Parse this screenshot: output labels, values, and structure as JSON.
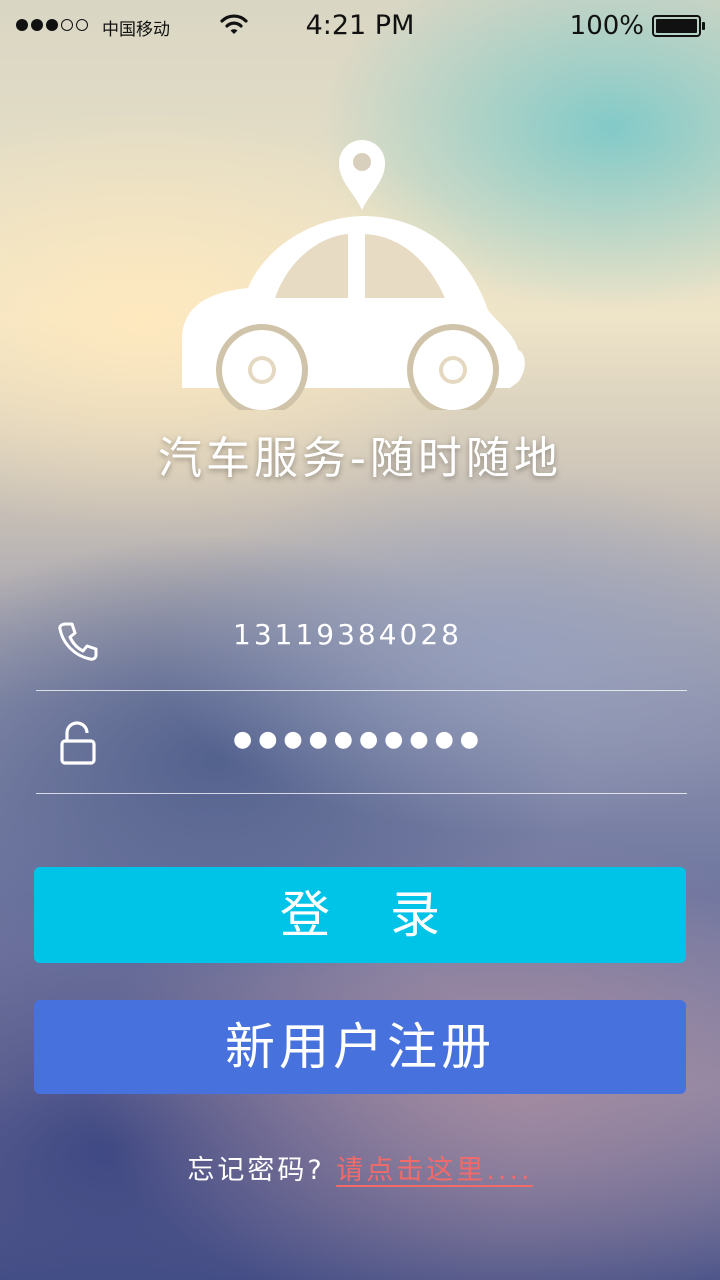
{
  "status_bar": {
    "carrier": "中国移动",
    "time": "4:21 PM",
    "battery": "100%",
    "signal_bars_filled": 3,
    "signal_bars_total": 5
  },
  "app": {
    "slogan": "汽车服务-随时随地",
    "logo_icon": "car-location-pin-icon"
  },
  "form": {
    "phone": {
      "icon": "phone-icon",
      "value": "13119384028"
    },
    "password": {
      "icon": "unlock-icon",
      "value": "●●●●●●●●●●"
    }
  },
  "buttons": {
    "login_label": "登录",
    "register_label": "新用户注册"
  },
  "forgot": {
    "label": "忘记密码?",
    "link": "请点击这里...."
  },
  "colors": {
    "login_button": "#00c3e8",
    "register_button": "#4772dd",
    "link": "#f26a6a"
  }
}
